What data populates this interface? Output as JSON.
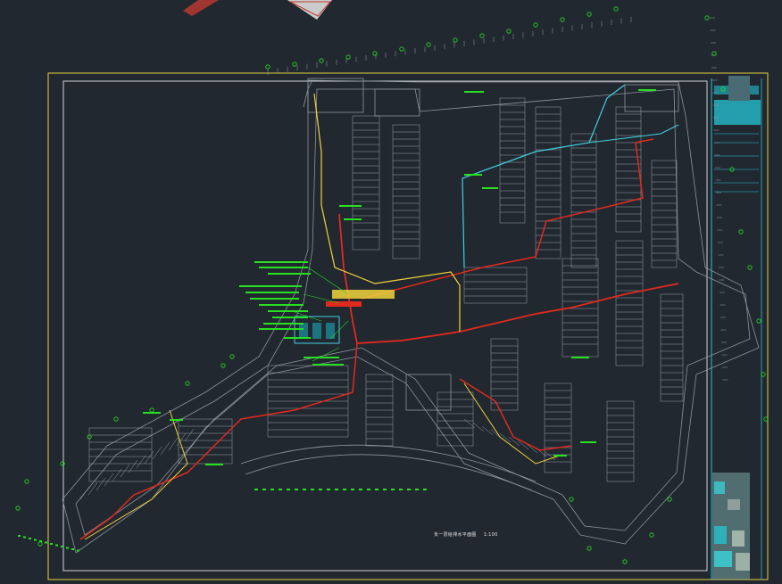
{
  "app": {
    "canvas_background": "#212830",
    "drawing_title": "负一层给排水平面图",
    "drawing_scale": "1:100"
  },
  "colors": {
    "frame_outer": "#c8b43c",
    "frame_inner": "#cfd3d6",
    "wall_lines": "#8c949c",
    "parking_lines": "#9aa1a8",
    "pipe_red": "#e02a1e",
    "pipe_yellow": "#f0d23c",
    "pipe_cyan": "#3fd0e0",
    "annotation_green": "#27e020",
    "title_block_cyan": "#25c6d6"
  },
  "layers": {
    "frame": "drawing-frame",
    "building": "building-outline",
    "parking": "parking-grid",
    "pipes": "pipe-network",
    "annotations": "green-leader-labels",
    "title_block": "title-block"
  }
}
